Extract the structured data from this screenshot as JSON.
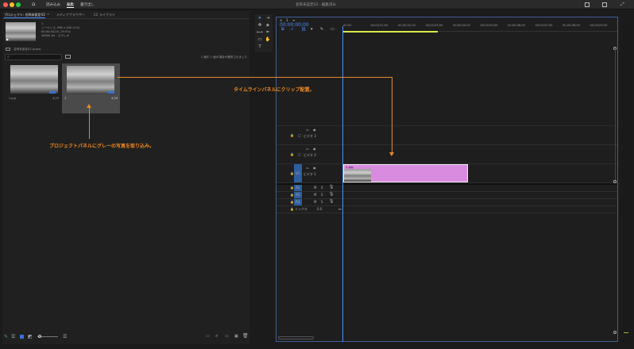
{
  "titlebar": {
    "home_icon": "home-icon",
    "tabs": [
      "読み込み",
      "編集",
      "書き出し"
    ],
    "active_tab": "編集",
    "window_title": "名称未設定V2 - 編集済み",
    "right_icons": [
      "share-icon",
      "panel-layout-icon",
      "fullscreen-icon"
    ]
  },
  "project_panel": {
    "tabs": [
      "プロジェクト: 名称未設定V2",
      "メディアブラウザー",
      "CC ライブラリ"
    ],
    "preview": {
      "name": "1",
      "line1": "シーケンス, 960 x 450 (1.0)",
      "line2": "00;00;04;25, 29.97p",
      "line3": "48000 Hz - ステレオ"
    },
    "project_file": "名称未設定V2.prproj",
    "search_placeholder": "",
    "selection_status": "2 個中 1 個の項目が選択されました",
    "items": [
      {
        "name": "1.jpg",
        "duration": "4;29"
      },
      {
        "name": "1",
        "duration": "4;29"
      }
    ],
    "footer_icons": [
      "pencil-icon",
      "list-view-icon",
      "icon-view-icon",
      "freeform-view-icon",
      "zoom-slider",
      "sort-icon",
      "automate-icon",
      "find-icon",
      "new-bin-icon",
      "new-item-icon",
      "delete-icon"
    ]
  },
  "tools": [
    "selection-tool",
    "track-select-tool",
    "ripple-edit-tool",
    "razor-tool",
    "slip-tool",
    "pen-tool",
    "rectangle-tool",
    "hand-tool",
    "type-tool"
  ],
  "timeline": {
    "tab_label": "1",
    "timecode": "00;00;00;00",
    "ruler_labels": [
      "00;00",
      "00;00;01;00",
      "00;00;02;00",
      "00;00;03;00",
      "00;00;04;00",
      "00;00;05;00",
      "00;00;06;00",
      "00;00;07;00",
      "00;00;08;00",
      "00;00;09;00"
    ],
    "video_tracks": [
      {
        "id": "V3",
        "name": "ビデオ 3"
      },
      {
        "id": "V2",
        "name": "ビデオ 2"
      },
      {
        "id": "V1",
        "name": "ビデオ 1"
      }
    ],
    "audio_tracks": [
      {
        "id": "A1",
        "mute": "M",
        "solo": "S"
      },
      {
        "id": "A2",
        "mute": "M",
        "solo": "S"
      },
      {
        "id": "A3",
        "mute": "M",
        "solo": "S"
      }
    ],
    "mix_label": "ミックス",
    "mix_value": "0.0",
    "clip": {
      "label": "1.jpg",
      "color": "#d98be0"
    }
  },
  "annotations": {
    "timeline_note": "タイムラインパネルにクリップ配置。",
    "project_note": "プロジェクトパネルにグレーの写真を取り込み。"
  }
}
